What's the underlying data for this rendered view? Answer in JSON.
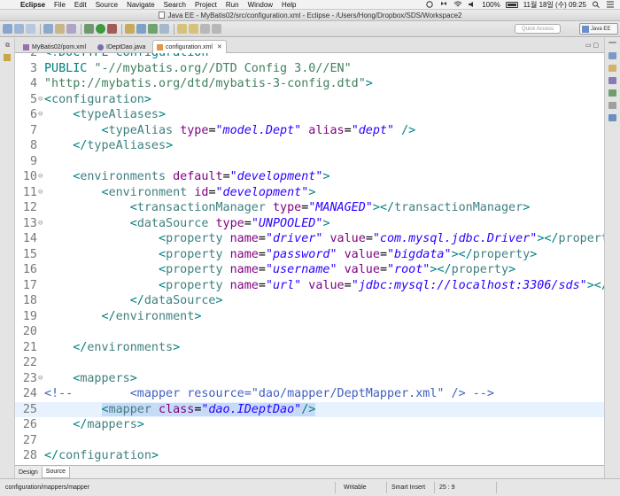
{
  "menubar": {
    "app_name": "Eclipse",
    "items": [
      "File",
      "Edit",
      "Source",
      "Navigate",
      "Search",
      "Project",
      "Run",
      "Window",
      "Help"
    ],
    "battery": "100%",
    "datetime": "11월 18일 (수)  09:25"
  },
  "window": {
    "title": "Java EE - MyBatis02/src/configuration.xml - Eclipse - /Users/Hong/Dropbox/SDS/Workspace2"
  },
  "toolbar": {
    "quick_access_placeholder": "Quick Access",
    "perspective_label": "Java EE"
  },
  "tabs": [
    {
      "label": "MyBatis02/pom.xml",
      "icon": "maven-xml-icon",
      "active": false
    },
    {
      "label": "IDeptDao.java",
      "icon": "java-interface-icon",
      "active": false
    },
    {
      "label": "configuration.xml",
      "icon": "xml-file-icon",
      "active": true
    }
  ],
  "editor": {
    "lines": [
      {
        "n": "2",
        "fold": "",
        "segs": [
          {
            "c": "t-doctype",
            "t": "<!DOCTYPE configuration"
          }
        ]
      },
      {
        "n": "3",
        "fold": "",
        "segs": [
          {
            "c": "t-doctype",
            "t": "PUBLIC "
          },
          {
            "c": "t-str",
            "t": "\"-//mybatis.org//DTD Config 3.0//EN\""
          }
        ]
      },
      {
        "n": "4",
        "fold": "",
        "segs": [
          {
            "c": "t-str",
            "t": "\"http://mybatis.org/dtd/mybatis-3-config.dtd\""
          },
          {
            "c": "t-doctype",
            "t": ">"
          }
        ]
      },
      {
        "n": "5",
        "fold": "⊖",
        "segs": [
          {
            "c": "t-bracket",
            "t": "<"
          },
          {
            "c": "t-tag",
            "t": "configuration"
          },
          {
            "c": "t-bracket",
            "t": ">"
          }
        ]
      },
      {
        "n": "6",
        "fold": "⊖",
        "segs": [
          {
            "c": "t-text",
            "t": "    "
          },
          {
            "c": "t-bracket",
            "t": "<"
          },
          {
            "c": "t-tag",
            "t": "typeAliases"
          },
          {
            "c": "t-bracket",
            "t": ">"
          }
        ]
      },
      {
        "n": "7",
        "fold": "",
        "segs": [
          {
            "c": "t-text",
            "t": "        "
          },
          {
            "c": "t-bracket",
            "t": "<"
          },
          {
            "c": "t-tag",
            "t": "typeAlias "
          },
          {
            "c": "t-attr",
            "t": "type"
          },
          {
            "c": "t-text",
            "t": "="
          },
          {
            "c": "t-val",
            "t": "\"model.Dept\""
          },
          {
            "c": "t-attr",
            "t": " alias"
          },
          {
            "c": "t-text",
            "t": "="
          },
          {
            "c": "t-val",
            "t": "\"dept\""
          },
          {
            "c": "t-bracket",
            "t": " />"
          }
        ]
      },
      {
        "n": "8",
        "fold": "",
        "segs": [
          {
            "c": "t-text",
            "t": "    "
          },
          {
            "c": "t-bracket",
            "t": "</"
          },
          {
            "c": "t-tag",
            "t": "typeAliases"
          },
          {
            "c": "t-bracket",
            "t": ">"
          }
        ]
      },
      {
        "n": "9",
        "fold": "",
        "segs": []
      },
      {
        "n": "10",
        "fold": "⊖",
        "segs": [
          {
            "c": "t-text",
            "t": "    "
          },
          {
            "c": "t-bracket",
            "t": "<"
          },
          {
            "c": "t-tag",
            "t": "environments "
          },
          {
            "c": "t-attr",
            "t": "default"
          },
          {
            "c": "t-text",
            "t": "="
          },
          {
            "c": "t-val",
            "t": "\"development\""
          },
          {
            "c": "t-bracket",
            "t": ">"
          }
        ]
      },
      {
        "n": "11",
        "fold": "⊖",
        "segs": [
          {
            "c": "t-text",
            "t": "        "
          },
          {
            "c": "t-bracket",
            "t": "<"
          },
          {
            "c": "t-tag",
            "t": "environment "
          },
          {
            "c": "t-attr",
            "t": "id"
          },
          {
            "c": "t-text",
            "t": "="
          },
          {
            "c": "t-val",
            "t": "\"development\""
          },
          {
            "c": "t-bracket",
            "t": ">"
          }
        ]
      },
      {
        "n": "12",
        "fold": "",
        "segs": [
          {
            "c": "t-text",
            "t": "            "
          },
          {
            "c": "t-bracket",
            "t": "<"
          },
          {
            "c": "t-tag",
            "t": "transactionManager "
          },
          {
            "c": "t-attr",
            "t": "type"
          },
          {
            "c": "t-text",
            "t": "="
          },
          {
            "c": "t-val",
            "t": "\"MANAGED\""
          },
          {
            "c": "t-bracket",
            "t": "></"
          },
          {
            "c": "t-tag",
            "t": "transactionManager"
          },
          {
            "c": "t-bracket",
            "t": ">"
          }
        ]
      },
      {
        "n": "13",
        "fold": "⊖",
        "segs": [
          {
            "c": "t-text",
            "t": "            "
          },
          {
            "c": "t-bracket",
            "t": "<"
          },
          {
            "c": "t-tag",
            "t": "dataSource "
          },
          {
            "c": "t-attr",
            "t": "type"
          },
          {
            "c": "t-text",
            "t": "="
          },
          {
            "c": "t-val",
            "t": "\"UNPOOLED\""
          },
          {
            "c": "t-bracket",
            "t": ">"
          }
        ]
      },
      {
        "n": "14",
        "fold": "",
        "segs": [
          {
            "c": "t-text",
            "t": "                "
          },
          {
            "c": "t-bracket",
            "t": "<"
          },
          {
            "c": "t-tag",
            "t": "property "
          },
          {
            "c": "t-attr",
            "t": "name"
          },
          {
            "c": "t-text",
            "t": "="
          },
          {
            "c": "t-val",
            "t": "\"driver\""
          },
          {
            "c": "t-attr",
            "t": " value"
          },
          {
            "c": "t-text",
            "t": "="
          },
          {
            "c": "t-val",
            "t": "\"com.mysql.jdbc.Driver\""
          },
          {
            "c": "t-bracket",
            "t": "></"
          },
          {
            "c": "t-tag",
            "t": "propert"
          }
        ]
      },
      {
        "n": "15",
        "fold": "",
        "segs": [
          {
            "c": "t-text",
            "t": "                "
          },
          {
            "c": "t-bracket",
            "t": "<"
          },
          {
            "c": "t-tag",
            "t": "property "
          },
          {
            "c": "t-attr",
            "t": "name"
          },
          {
            "c": "t-text",
            "t": "="
          },
          {
            "c": "t-val",
            "t": "\"password\""
          },
          {
            "c": "t-attr",
            "t": " value"
          },
          {
            "c": "t-text",
            "t": "="
          },
          {
            "c": "t-val",
            "t": "\"bigdata\""
          },
          {
            "c": "t-bracket",
            "t": "></"
          },
          {
            "c": "t-tag",
            "t": "property"
          },
          {
            "c": "t-bracket",
            "t": ">"
          }
        ]
      },
      {
        "n": "16",
        "fold": "",
        "segs": [
          {
            "c": "t-text",
            "t": "                "
          },
          {
            "c": "t-bracket",
            "t": "<"
          },
          {
            "c": "t-tag",
            "t": "property "
          },
          {
            "c": "t-attr",
            "t": "name"
          },
          {
            "c": "t-text",
            "t": "="
          },
          {
            "c": "t-val",
            "t": "\"username\""
          },
          {
            "c": "t-attr",
            "t": " value"
          },
          {
            "c": "t-text",
            "t": "="
          },
          {
            "c": "t-val",
            "t": "\"root\""
          },
          {
            "c": "t-bracket",
            "t": "></"
          },
          {
            "c": "t-tag",
            "t": "property"
          },
          {
            "c": "t-bracket",
            "t": ">"
          }
        ]
      },
      {
        "n": "17",
        "fold": "",
        "segs": [
          {
            "c": "t-text",
            "t": "                "
          },
          {
            "c": "t-bracket",
            "t": "<"
          },
          {
            "c": "t-tag",
            "t": "property "
          },
          {
            "c": "t-attr",
            "t": "name"
          },
          {
            "c": "t-text",
            "t": "="
          },
          {
            "c": "t-val",
            "t": "\"url\""
          },
          {
            "c": "t-attr",
            "t": " value"
          },
          {
            "c": "t-text",
            "t": "="
          },
          {
            "c": "t-val",
            "t": "\"jdbc:mysql://localhost:3306/sds\""
          },
          {
            "c": "t-bracket",
            "t": "></"
          }
        ]
      },
      {
        "n": "18",
        "fold": "",
        "segs": [
          {
            "c": "t-text",
            "t": "            "
          },
          {
            "c": "t-bracket",
            "t": "</"
          },
          {
            "c": "t-tag",
            "t": "dataSource"
          },
          {
            "c": "t-bracket",
            "t": ">"
          }
        ]
      },
      {
        "n": "19",
        "fold": "",
        "segs": [
          {
            "c": "t-text",
            "t": "        "
          },
          {
            "c": "t-bracket",
            "t": "</"
          },
          {
            "c": "t-tag",
            "t": "environment"
          },
          {
            "c": "t-bracket",
            "t": ">"
          }
        ]
      },
      {
        "n": "20",
        "fold": "",
        "segs": []
      },
      {
        "n": "21",
        "fold": "",
        "segs": [
          {
            "c": "t-text",
            "t": "    "
          },
          {
            "c": "t-bracket",
            "t": "</"
          },
          {
            "c": "t-tag",
            "t": "environments"
          },
          {
            "c": "t-bracket",
            "t": ">"
          }
        ]
      },
      {
        "n": "22",
        "fold": "",
        "segs": []
      },
      {
        "n": "23",
        "fold": "⊖",
        "segs": [
          {
            "c": "t-text",
            "t": "    "
          },
          {
            "c": "t-bracket",
            "t": "<"
          },
          {
            "c": "t-tag",
            "t": "mappers"
          },
          {
            "c": "t-bracket",
            "t": ">"
          }
        ]
      },
      {
        "n": "24",
        "fold": "",
        "segs": [
          {
            "c": "t-comment",
            "t": "<!--        <mapper resource=\"dao/mapper/DeptMapper.xml\" /> -->"
          }
        ]
      },
      {
        "n": "25",
        "fold": "",
        "cur": true,
        "segs": [
          {
            "c": "t-text",
            "t": "        "
          },
          {
            "c": "t-bracket sel",
            "t": "<"
          },
          {
            "c": "t-tag sel",
            "t": "mapper "
          },
          {
            "c": "t-attr sel",
            "t": "class"
          },
          {
            "c": "t-text sel",
            "t": "="
          },
          {
            "c": "t-val sel",
            "t": "\"dao.IDeptDao\""
          },
          {
            "c": "t-bracket sel",
            "t": "/>"
          }
        ]
      },
      {
        "n": "26",
        "fold": "",
        "segs": [
          {
            "c": "t-text",
            "t": "    "
          },
          {
            "c": "t-bracket",
            "t": "</"
          },
          {
            "c": "t-tag",
            "t": "mappers"
          },
          {
            "c": "t-bracket",
            "t": ">"
          }
        ]
      },
      {
        "n": "27",
        "fold": "",
        "segs": []
      },
      {
        "n": "28",
        "fold": "",
        "segs": [
          {
            "c": "t-bracket",
            "t": "</"
          },
          {
            "c": "t-tag",
            "t": "configuration"
          },
          {
            "c": "t-bracket",
            "t": ">"
          }
        ]
      }
    ]
  },
  "source_tabs": [
    {
      "label": "Design",
      "active": false
    },
    {
      "label": "Source",
      "active": true
    }
  ],
  "status": {
    "path": "configuration/mappers/mapper",
    "mode": "Writable",
    "insert": "Smart Insert",
    "position": "25 : 9"
  }
}
